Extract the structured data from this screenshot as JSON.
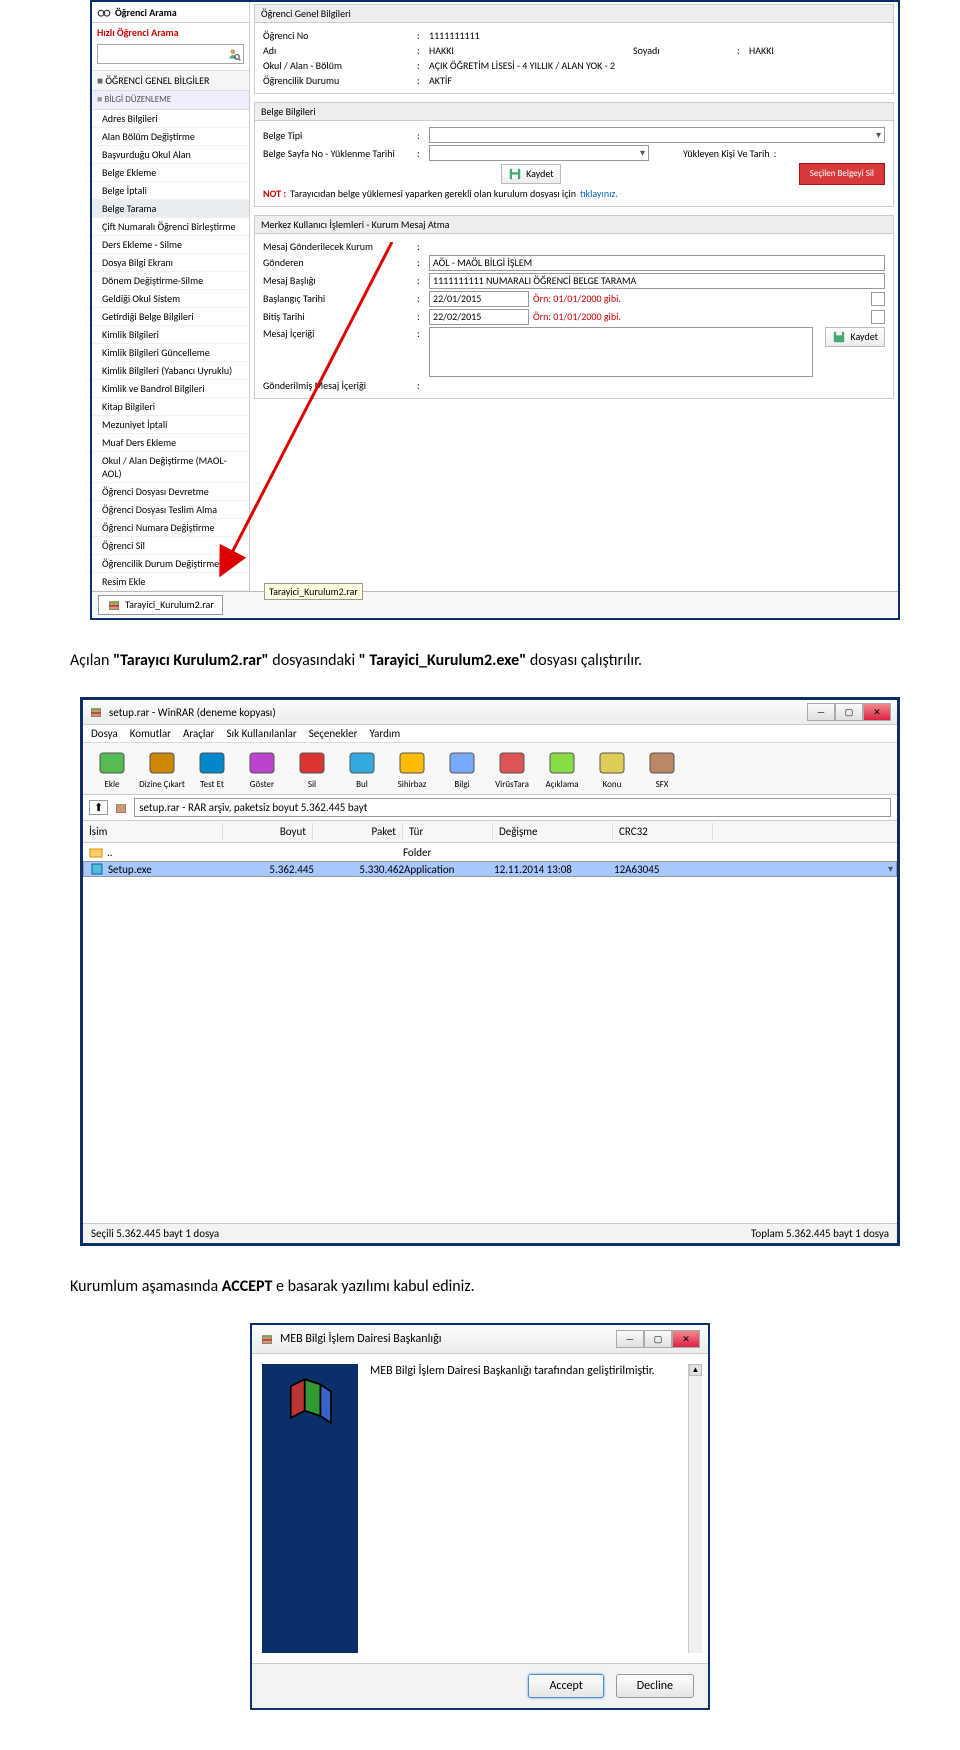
{
  "doc": {
    "para1_prefix": "Açılan ",
    "para1_b1": "\"Tarayıcı Kurulum2.rar\"",
    "para1_mid": " dosyasındaki ",
    "para1_b2": "\" Tarayici_Kurulum2.exe\"",
    "para1_suffix": " dosyası çalıştırılır.",
    "para2_prefix": "Kurumlum aşamasında ",
    "para2_b1": "ACCEPT",
    "para2_suffix": " e basarak yazılımı kabul ediniz."
  },
  "s1": {
    "sb_title": "Öğrenci Arama",
    "sb_search_label": "Hızlı Öğrenci Arama",
    "sb_section1": "ÖĞRENCİ GENEL BİLGİLER",
    "sb_section2": "BİLGİ DÜZENLEME",
    "items": [
      "Adres Bilgileri",
      "Alan Bölüm Değiştirme",
      "Başvurduğu Okul Alan",
      "Belge Ekleme",
      "Belge İptali",
      "Belge Tarama",
      "Çift Numaralı Öğrenci Birleştirme",
      "Ders Ekleme - Silme",
      "Dosya Bilgi Ekranı",
      "Dönem Değiştirme-Silme",
      "Geldiği Okul Sistem",
      "Getirdiği Belge Bilgileri",
      "Kimlik Bilgileri",
      "Kimlik Bilgileri Güncelleme",
      "Kimlik Bilgileri (Yabancı Uyruklu)",
      "Kimlik ve Bandrol Bilgileri",
      "Kitap Bilgileri",
      "Mezuniyet İptali",
      "Muaf Ders Ekleme",
      "Okul / Alan Değiştirme (MAOL-AOL)",
      "Öğrenci Dosyası Devretme",
      "Öğrenci Dosyası Teslim Alma",
      "Öğrenci Numara Değiştirme",
      "Öğrenci Sil",
      "Öğrencilik Durum Değiştirme",
      "Resim Ekle"
    ],
    "panel1_head": "Öğrenci Genel Bilgileri",
    "p1_no_lbl": "Öğrenci No",
    "p1_no": "1111111111",
    "p1_ad_lbl": "Adı",
    "p1_ad": "HAKKI",
    "p1_soyad_lbl": "Soyadı",
    "p1_soyad": "HAKKI",
    "p1_okul_lbl": "Okul / Alan - Bölüm",
    "p1_okul": "AÇIK ÖĞRETİM LİSESİ - 4 YILLIK / ALAN YOK - 2",
    "p1_durum_lbl": "Öğrencilik Durumu",
    "p1_durum": "AKTİF",
    "panel2_head": "Belge Bilgileri",
    "p2_tip_lbl": "Belge Tipi",
    "p2_sayfa_lbl": "Belge Sayfa No - Yüklenme Tarihi",
    "p2_kisi_lbl": "Yükleyen Kişi Ve Tarih",
    "p2_kaydet": "Kaydet",
    "p2_sil": "Seçilen Belgeyi Sil",
    "p2_not_lbl": "NOT :",
    "p2_not_txt": " Tarayıcıdan belge yüklemesi yaparken gerekli olan kurulum dosyası için ",
    "p2_not_link": "tıklayınız.",
    "panel3_head": "Merkez Kullanıcı İşlemleri - Kurum Mesaj Atma",
    "p3_kurum_lbl": "Mesaj Gönderilecek Kurum",
    "p3_gonderen_lbl": "Gönderen",
    "p3_gonderen": "AÖL - MAÖL BİLGİ İŞLEM",
    "p3_baslik_lbl": "Mesaj Başlığı",
    "p3_baslik": "1111111111 NUMARALI ÖĞRENCİ BELGE TARAMA",
    "p3_bas_lbl": "Başlangıç Tarihi",
    "p3_bas": "22/01/2015",
    "p3_bit_lbl": "Bitiş Tarihi",
    "p3_bit": "22/02/2015",
    "p3_hint": "Örn: 01/01/2000 gibi.",
    "p3_icerik_lbl": "Mesaj İçeriği",
    "p3_gicerik_lbl": "Gönderilmiş Mesaj İçeriği",
    "p3_kaydet": "Kaydet",
    "task_label": "Tarayici_Kurulum2.rar",
    "tooltip": "Tarayici_Kurulum2.rar"
  },
  "s2": {
    "title": "setup.rar - WinRAR (deneme kopyası)",
    "menu": [
      "Dosya",
      "Komutlar",
      "Araçlar",
      "Sık Kullanılanlar",
      "Seçenekler",
      "Yardım"
    ],
    "toolbar": [
      "Ekle",
      "Dizine Çıkart",
      "Test Et",
      "Göster",
      "Sil",
      "Bul",
      "Sihirbaz",
      "Bilgi",
      "VirüsTara",
      "Açıklama",
      "Konu",
      "SFX"
    ],
    "addr": "setup.rar - RAR arşiv, paketsiz boyut 5.362.445 bayt",
    "cols": {
      "name": "İsim",
      "size": "Boyut",
      "pack": "Paket",
      "type": "Tür",
      "date": "Değişme",
      "crc": "CRC32"
    },
    "row_up": {
      "name": "..",
      "type": "Folder"
    },
    "row_sel": {
      "name": "Setup.exe",
      "size": "5.362.445",
      "pack": "5.330.462",
      "type": "Application",
      "date": "12.11.2014 13:08",
      "crc": "12A63045"
    },
    "status_left": "Seçili 5.362.445 bayt 1 dosya",
    "status_right": "Toplam 5.362.445 bayt 1 dosya"
  },
  "s3": {
    "title": "MEB Bilgi İşlem Dairesi Başkanlığı",
    "body": "MEB Bilgi İşlem Dairesi Başkanlığı tarafından geliştirilmiştir.",
    "accept": "Accept",
    "decline": "Decline"
  }
}
